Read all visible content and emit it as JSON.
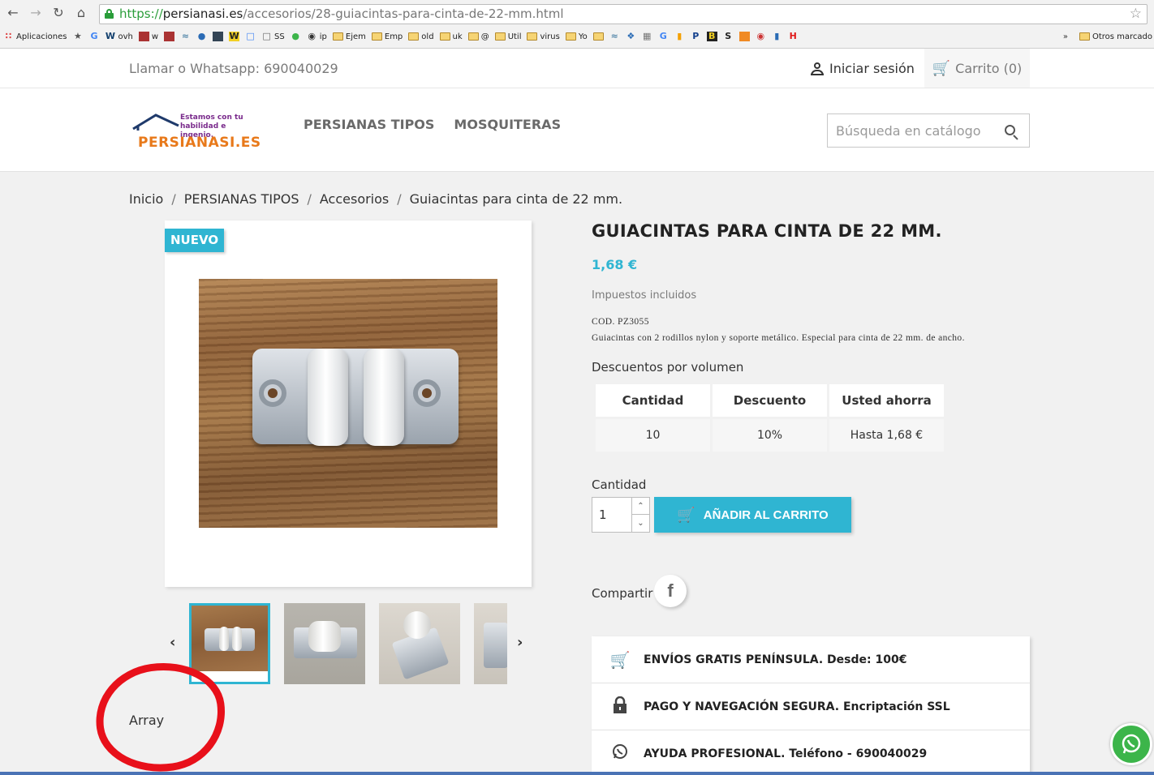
{
  "browser": {
    "url_scheme": "https://",
    "url_host": "persianasi.es",
    "url_path": "/accesorios/28-guiacintas-para-cinta-de-22-mm.html",
    "bookmarks": [
      {
        "label": "Aplicaciones",
        "icon": "apps-icon"
      },
      {
        "label": "",
        "icon": "star-icon"
      },
      {
        "label": "",
        "icon": "google-icon"
      },
      {
        "label": "ovh",
        "icon": "ovh-icon"
      },
      {
        "label": "w",
        "icon": "site-icon"
      },
      {
        "label": "",
        "icon": "site-icon"
      },
      {
        "label": "",
        "icon": "site-icon"
      },
      {
        "label": "",
        "icon": "site-icon"
      },
      {
        "label": "",
        "icon": "site-icon"
      },
      {
        "label": "",
        "icon": "w-icon"
      },
      {
        "label": "",
        "icon": "translate-icon"
      },
      {
        "label": "SS",
        "icon": "page-icon"
      },
      {
        "label": "",
        "icon": "whatsapp-icon"
      },
      {
        "label": "ip",
        "icon": "ip-icon"
      },
      {
        "label": "Ejem",
        "icon": "folder-icon"
      },
      {
        "label": "Emp",
        "icon": "folder-icon"
      },
      {
        "label": "old",
        "icon": "folder-icon"
      },
      {
        "label": "uk",
        "icon": "folder-icon"
      },
      {
        "label": "@",
        "icon": "folder-icon"
      },
      {
        "label": "Util",
        "icon": "folder-icon"
      },
      {
        "label": "virus",
        "icon": "folder-icon"
      },
      {
        "label": "Yo",
        "icon": "folder-icon"
      },
      {
        "label": "",
        "icon": "folder-icon"
      }
    ],
    "bookmarks_more": "»",
    "other_bookmarks": "Otros marcado"
  },
  "topnav": {
    "phone": "Llamar o Whatsapp: 690040029",
    "signin": "Iniciar sesión",
    "cart": "Carrito (0)"
  },
  "header": {
    "logo_tagline_1": "Estamos con tu",
    "logo_tagline_2": "habilidad e ingenio.",
    "logo_brand": "PERSIANASI.ES",
    "menu": [
      "PERSIANAS TIPOS",
      "MOSQUITERAS"
    ],
    "search_placeholder": "Búsqueda en catálogo"
  },
  "breadcrumb": [
    "Inicio",
    "PERSIANAS TIPOS",
    "Accesorios",
    "Guiacintas para cinta de 22 mm."
  ],
  "breadcrumb_sep": "/",
  "product": {
    "badge": "NUEVO",
    "title": "GUIACINTAS PARA CINTA DE 22 MM.",
    "price": "1,68 €",
    "tax_note": "Impuestos incluidos",
    "desc_line1": "COD. PZ3055",
    "desc_line2": "Guiacintas con 2 rodillos nylon y soporte metálico. Especial para cinta de 22 mm. de ancho.",
    "volume_title": "Descuentos por volumen",
    "volume_headers": [
      "Cantidad",
      "Descuento",
      "Usted ahorra"
    ],
    "volume_row": [
      "10",
      "10%",
      "Hasta 1,68 €"
    ],
    "quantity_label": "Cantidad",
    "quantity_value": "1",
    "add_to_cart": "AÑADIR AL CARRITO",
    "share_label": "Compartir",
    "facebook_glyph": "f",
    "thumb_prev": "‹",
    "thumb_next": "›"
  },
  "reassurance": [
    {
      "icon": "shipping-cart-icon",
      "text": "ENVÍOS GRATIS PENÍNSULA. Desde: 100€"
    },
    {
      "icon": "padlock-icon",
      "text": "PAGO Y NAVEGACIÓN SEGURA. Encriptación SSL"
    },
    {
      "icon": "whatsapp-icon",
      "text": "AYUDA PROFESIONAL. Teléfono - 690040029"
    }
  ],
  "note": "Array",
  "colors": {
    "accent": "#2fb5d2",
    "annotation": "#e8101a",
    "whatsapp": "#3cb54a",
    "logo_orange": "#e8791a",
    "logo_purple": "#7a2b8c"
  }
}
